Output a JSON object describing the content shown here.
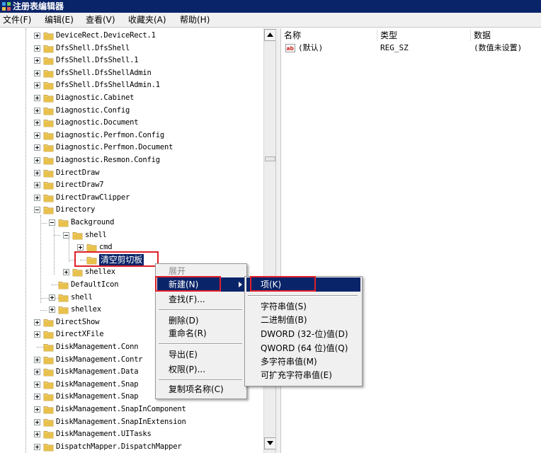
{
  "window": {
    "title": "注册表编辑器"
  },
  "menubar": [
    "文件(F)",
    "编辑(E)",
    "查看(V)",
    "收藏夹(A)",
    "帮助(H)"
  ],
  "tree": [
    "DeviceRect.DeviceRect.1",
    "DfsShell.DfsShell",
    "DfsShell.DfsShell.1",
    "DfsShell.DfsShellAdmin",
    "DfsShell.DfsShellAdmin.1",
    "Diagnostic.Cabinet",
    "Diagnostic.Config",
    "Diagnostic.Document",
    "Diagnostic.Perfmon.Config",
    "Diagnostic.Perfmon.Document",
    "Diagnostic.Resmon.Config",
    "DirectDraw",
    "DirectDraw7",
    "DirectDrawClipper",
    "Directory",
    "Background",
    "shell",
    "cmd",
    "清空剪切板",
    "shellex",
    "DefaultIcon",
    "shell",
    "shellex",
    "DirectShow",
    "DirectXFile",
    "DiskManagement.Conn",
    "DiskManagement.Contr",
    "DiskManagement.Data",
    "DiskManagement.Snap",
    "DiskManagement.Snap",
    "DiskManagement.SnapInComponent",
    "DiskManagement.SnapInExtension",
    "DiskManagement.UITasks",
    "DispatchMapper.DispatchMapper"
  ],
  "values_pane": {
    "columns": [
      "名称",
      "类型",
      "数据"
    ],
    "rows": [
      {
        "name": "(默认)",
        "type": "REG_SZ",
        "data": "(数值未设置)",
        "icon": "string-value-icon"
      }
    ]
  },
  "context_menu": {
    "items": [
      "展开",
      "新建(N)",
      "查找(F)...",
      "删除(D)",
      "重命名(R)",
      "导出(E)",
      "权限(P)...",
      "复制项名称(C)"
    ]
  },
  "submenu": {
    "items": [
      "项(K)",
      "字符串值(S)",
      "二进制值(B)",
      "DWORD (32-位)值(D)",
      "QWORD (64 位)值(Q)",
      "多字符串值(M)",
      "可扩充字符串值(E)"
    ]
  },
  "colors": {
    "titlebar": "#0a246a",
    "highlight": "#0a246a",
    "annotation": "#e0202a",
    "folder": "#e8c14c"
  }
}
